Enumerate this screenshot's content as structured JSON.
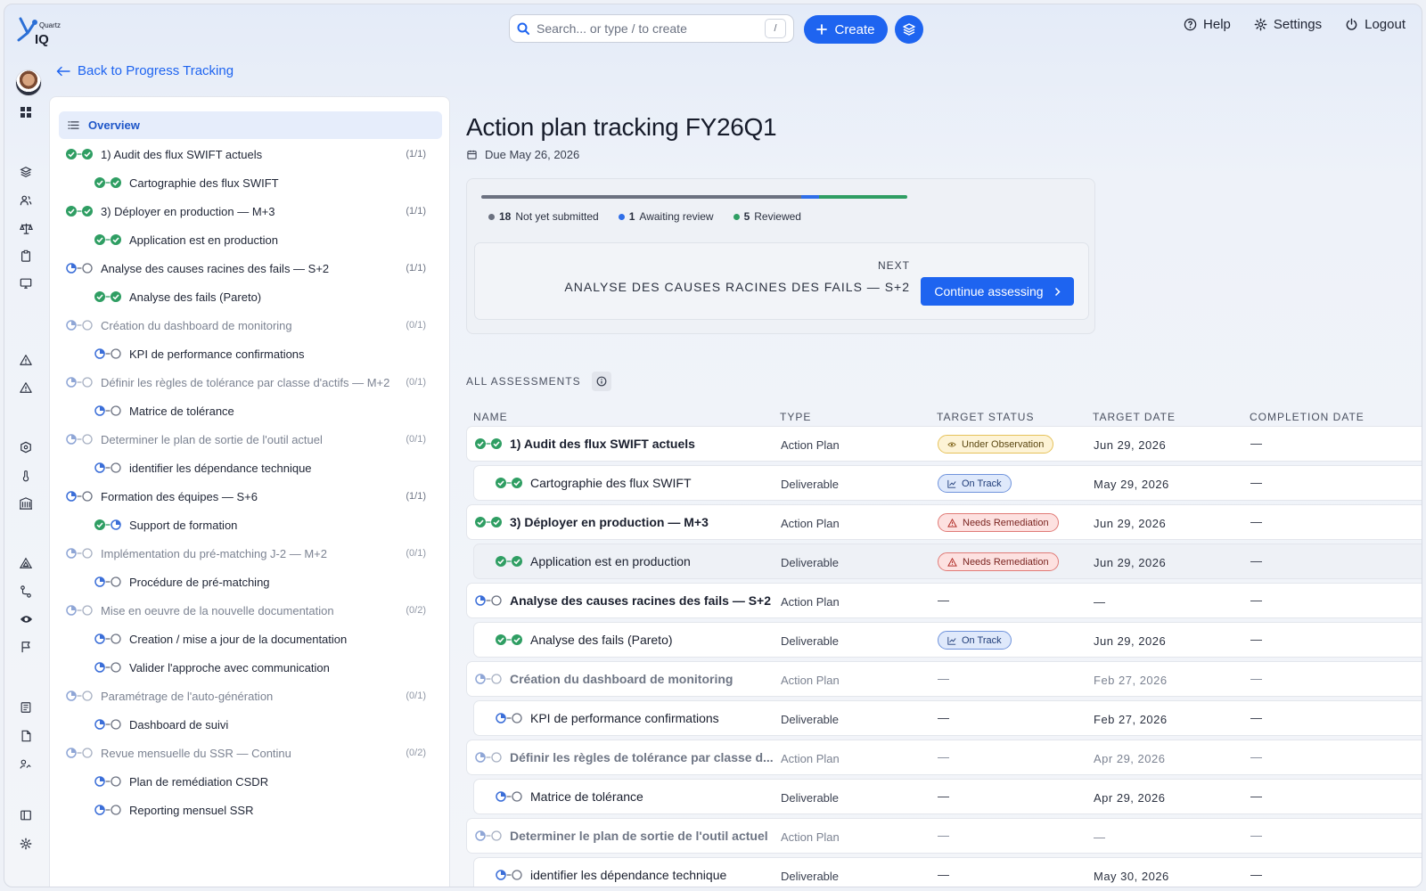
{
  "app": {
    "brand": "Quartz IQ",
    "brand_small": "Quartz",
    "brand_large": "IQ"
  },
  "header": {
    "search_placeholder": "Search... or type / to create",
    "search_shortcut": "/",
    "create_label": "Create",
    "links": [
      {
        "label": "Help",
        "icon": "help-circle-icon"
      },
      {
        "label": "Settings",
        "icon": "gear-icon"
      },
      {
        "label": "Logout",
        "icon": "power-icon"
      }
    ]
  },
  "back_link": "Back to Progress Tracking",
  "sidebar": {
    "overview_label": "Overview",
    "tree": [
      {
        "label": "1) Audit des flux SWIFT actuels",
        "count": "(1/1)",
        "level": 0,
        "status": "done",
        "muted": false
      },
      {
        "label": "Cartographie des flux SWIFT",
        "count": "",
        "level": 1,
        "status": "done",
        "muted": false
      },
      {
        "label": "3) Déployer en production — M+3",
        "count": "(1/1)",
        "level": 0,
        "status": "done",
        "muted": false
      },
      {
        "label": "Application est en production",
        "count": "",
        "level": 1,
        "status": "done",
        "muted": false
      },
      {
        "label": "Analyse des causes racines des fails — S+2",
        "count": "(1/1)",
        "level": 0,
        "status": "partial",
        "muted": false
      },
      {
        "label": "Analyse des fails (Pareto)",
        "count": "",
        "level": 1,
        "status": "done",
        "muted": false
      },
      {
        "label": "Création du dashboard de monitoring",
        "count": "(0/1)",
        "level": 0,
        "status": "partial",
        "muted": true
      },
      {
        "label": "KPI de performance confirmations",
        "count": "",
        "level": 1,
        "status": "partial",
        "muted": false
      },
      {
        "label": "Définir les règles de tolérance par classe d'actifs — M+2",
        "count": "(0/1)",
        "level": 0,
        "status": "partial",
        "muted": true
      },
      {
        "label": "Matrice de tolérance",
        "count": "",
        "level": 1,
        "status": "partial",
        "muted": false
      },
      {
        "label": "Determiner le plan de sortie de l'outil actuel",
        "count": "(0/1)",
        "level": 0,
        "status": "partial",
        "muted": true
      },
      {
        "label": "identifier les dépendance technique",
        "count": "",
        "level": 1,
        "status": "partial",
        "muted": false
      },
      {
        "label": "Formation des équipes — S+6",
        "count": "(1/1)",
        "level": 0,
        "status": "partial",
        "muted": false
      },
      {
        "label": "Support de formation",
        "count": "",
        "level": 1,
        "status": "done-partial",
        "muted": false
      },
      {
        "label": "Implémentation du pré-matching J-2 — M+2",
        "count": "(0/1)",
        "level": 0,
        "status": "partial",
        "muted": true
      },
      {
        "label": "Procédure de pré-matching",
        "count": "",
        "level": 1,
        "status": "partial",
        "muted": false
      },
      {
        "label": "Mise en oeuvre de la nouvelle documentation",
        "count": "(0/2)",
        "level": 0,
        "status": "partial",
        "muted": true
      },
      {
        "label": "Creation / mise a jour de la documentation",
        "count": "",
        "level": 1,
        "status": "partial",
        "muted": false
      },
      {
        "label": "Valider l'approche avec communication",
        "count": "",
        "level": 1,
        "status": "partial",
        "muted": false
      },
      {
        "label": "Paramétrage de l'auto-génération",
        "count": "(0/1)",
        "level": 0,
        "status": "partial",
        "muted": true
      },
      {
        "label": "Dashboard de suivi",
        "count": "",
        "level": 1,
        "status": "partial",
        "muted": false
      },
      {
        "label": "Revue mensuelle du SSR — Continu",
        "count": "(0/2)",
        "level": 0,
        "status": "partial",
        "muted": true
      },
      {
        "label": "Plan de remédiation CSDR",
        "count": "",
        "level": 1,
        "status": "partial",
        "muted": false
      },
      {
        "label": "Reporting mensuel SSR",
        "count": "",
        "level": 1,
        "status": "partial",
        "muted": false
      }
    ]
  },
  "main": {
    "title": "Action plan tracking FY26Q1",
    "due": "Due May 26, 2026",
    "progress": {
      "not_submitted_count": "18",
      "not_submitted_label": "Not yet submitted",
      "awaiting_count": "1",
      "awaiting_label": "Awaiting review",
      "reviewed_count": "5",
      "reviewed_label": "Reviewed",
      "fractions": {
        "not_submitted": 0.75,
        "awaiting": 0.042,
        "reviewed": 0.208
      }
    },
    "next_label": "NEXT",
    "next_name": "ANALYSE DES CAUSES RACINES DES FAILS — S+2",
    "continue_label": "Continue assessing",
    "all_assessments_label": "ALL ASSESSMENTS",
    "columns": [
      "NAME",
      "TYPE",
      "TARGET STATUS",
      "TARGET DATE",
      "COMPLETION DATE"
    ],
    "rows": [
      {
        "name": "1) Audit des flux SWIFT actuels",
        "type": "Action Plan",
        "status": "Under Observation",
        "status_kind": "obs",
        "target": "Jun 29, 2026",
        "completion": "—",
        "child": false,
        "muted": false,
        "icon": "done",
        "highlight": false
      },
      {
        "name": "Cartographie des flux SWIFT",
        "type": "Deliverable",
        "status": "On Track",
        "status_kind": "track",
        "target": "May 29, 2026",
        "completion": "—",
        "child": true,
        "muted": false,
        "icon": "done",
        "highlight": false
      },
      {
        "name": "3) Déployer en production — M+3",
        "type": "Action Plan",
        "status": "Needs Remediation",
        "status_kind": "rem",
        "target": "Jun 29, 2026",
        "completion": "—",
        "child": false,
        "muted": false,
        "icon": "done",
        "highlight": false
      },
      {
        "name": "Application est en production",
        "type": "Deliverable",
        "status": "Needs Remediation",
        "status_kind": "rem",
        "target": "Jun 29, 2026",
        "completion": "—",
        "child": true,
        "muted": false,
        "icon": "done",
        "highlight": true
      },
      {
        "name": "Analyse des causes racines des fails — S+2",
        "type": "Action Plan",
        "status": "—",
        "status_kind": "none",
        "target": "—",
        "completion": "—",
        "child": false,
        "muted": false,
        "icon": "partial",
        "highlight": false
      },
      {
        "name": "Analyse des fails (Pareto)",
        "type": "Deliverable",
        "status": "On Track",
        "status_kind": "track",
        "target": "Jun 29, 2026",
        "completion": "—",
        "child": true,
        "muted": false,
        "icon": "done",
        "highlight": false
      },
      {
        "name": "Création du dashboard de monitoring",
        "type": "Action Plan",
        "status": "—",
        "status_kind": "none",
        "target": "Feb 27, 2026",
        "completion": "—",
        "child": false,
        "muted": true,
        "icon": "partial",
        "highlight": false
      },
      {
        "name": "KPI de performance confirmations",
        "type": "Deliverable",
        "status": "—",
        "status_kind": "none",
        "target": "Feb 27, 2026",
        "completion": "—",
        "child": true,
        "muted": false,
        "icon": "partial",
        "highlight": false
      },
      {
        "name": "Définir les règles de tolérance par classe d...",
        "type": "Action Plan",
        "status": "—",
        "status_kind": "none",
        "target": "Apr 29, 2026",
        "completion": "—",
        "child": false,
        "muted": true,
        "icon": "partial",
        "highlight": false
      },
      {
        "name": "Matrice de tolérance",
        "type": "Deliverable",
        "status": "—",
        "status_kind": "none",
        "target": "Apr 29, 2026",
        "completion": "—",
        "child": true,
        "muted": false,
        "icon": "partial",
        "highlight": false
      },
      {
        "name": "Determiner le plan de sortie de l'outil actuel",
        "type": "Action Plan",
        "status": "—",
        "status_kind": "none",
        "target": "—",
        "completion": "—",
        "child": false,
        "muted": true,
        "icon": "partial",
        "highlight": false
      },
      {
        "name": "identifier les dépendance technique",
        "type": "Deliverable",
        "status": "—",
        "status_kind": "none",
        "target": "May 30, 2026",
        "completion": "—",
        "child": true,
        "muted": false,
        "icon": "partial",
        "highlight": false
      }
    ]
  },
  "rail": [
    "grid-icon",
    "layers-icon",
    "users-icon",
    "scale-icon",
    "clipboard-icon",
    "monitor-icon",
    "alert-icon",
    "alert-icon",
    "shield-icon",
    "thermometer-icon",
    "building-icon",
    "triangle-icon",
    "route-icon",
    "eye-icon",
    "flag-icon",
    "bank-icon",
    "document-icon",
    "signature-icon",
    "panel-icon",
    "gear-icon"
  ],
  "colors": {
    "accent": "#1e64f0",
    "done": "#2f9e63",
    "pending": "#3b6ed8",
    "muted": "#a7b0c2",
    "grey": "#6b7180"
  }
}
